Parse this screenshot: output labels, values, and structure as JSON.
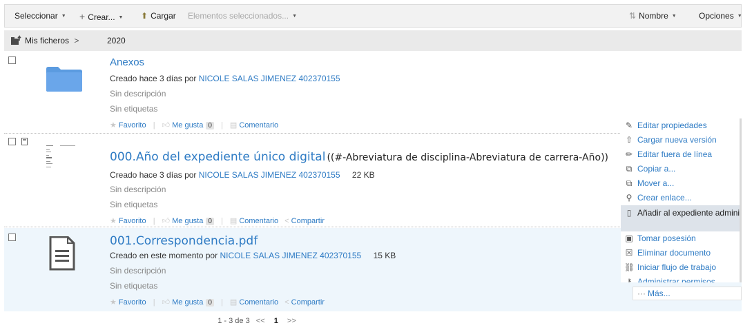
{
  "toolbar": {
    "select_label": "Seleccionar",
    "create_label": "Crear...",
    "upload_label": "Cargar",
    "selected_items_label": "Elementos seleccionados...",
    "sort_label": "Nombre",
    "options_label": "Opciones"
  },
  "breadcrumb": {
    "root": "Mis ficheros",
    "separator": ">",
    "current": "2020"
  },
  "items": [
    {
      "title": "Anexos",
      "title_extra": "",
      "created_prefix": "Creado hace 3 días por",
      "user": "NICOLE SALAS JIMENEZ 402370155",
      "size": "",
      "description": "Sin descripción",
      "tags": "Sin etiquetas",
      "favorite": "Favorito",
      "like": "Me gusta",
      "like_count": "0",
      "comment": "Comentario",
      "share": ""
    },
    {
      "title": "000.Año del expediente único digital",
      "title_extra": "((#-Abreviatura de disciplina-Abreviatura de carrera-Año))",
      "created_prefix": "Creado hace 3 días por",
      "user": "NICOLE SALAS JIMENEZ 402370155",
      "size": "22 KB",
      "description": "Sin descripción",
      "tags": "Sin etiquetas",
      "favorite": "Favorito",
      "like": "Me gusta",
      "like_count": "0",
      "comment": "Comentario",
      "share": "Compartir"
    },
    {
      "title": "001.Correspondencia.pdf",
      "title_extra": "",
      "created_prefix": "Creado en este momento por",
      "user": "NICOLE SALAS JIMENEZ 402370155",
      "size": "15 KB",
      "description": "Sin descripción",
      "tags": "Sin etiquetas",
      "favorite": "Favorito",
      "like": "Me gusta",
      "like_count": "0",
      "comment": "Comentario",
      "share": "Compartir"
    }
  ],
  "context_menu": {
    "items": [
      {
        "label": "Editar propiedades",
        "icon": "edit-properties-icon"
      },
      {
        "label": "Cargar nueva versión",
        "icon": "upload-version-icon"
      },
      {
        "label": "Editar fuera de línea",
        "icon": "pencil-icon"
      },
      {
        "label": "Copiar a...",
        "icon": "copy-icon"
      },
      {
        "label": "Mover a...",
        "icon": "move-icon"
      },
      {
        "label": "Crear enlace...",
        "icon": "link-icon"
      },
      {
        "label": "Añadir al expediente administrativo...",
        "icon": "file-record-icon"
      },
      {
        "label": "Tomar posesión",
        "icon": "take-ownership-icon"
      },
      {
        "label": "Eliminar documento",
        "icon": "delete-icon"
      },
      {
        "label": "Iniciar flujo de trabajo",
        "icon": "workflow-icon"
      },
      {
        "label": "Administrar permisos",
        "icon": "permissions-icon"
      }
    ],
    "more_label": "Más..."
  },
  "pagination": {
    "range": "1 - 3 de 3",
    "prev": "<<",
    "current": "1",
    "next": ">>"
  },
  "colors": {
    "link": "#2e7bc4",
    "selected_row": "#eef6fc",
    "menu_highlight": "#dde3ea"
  }
}
